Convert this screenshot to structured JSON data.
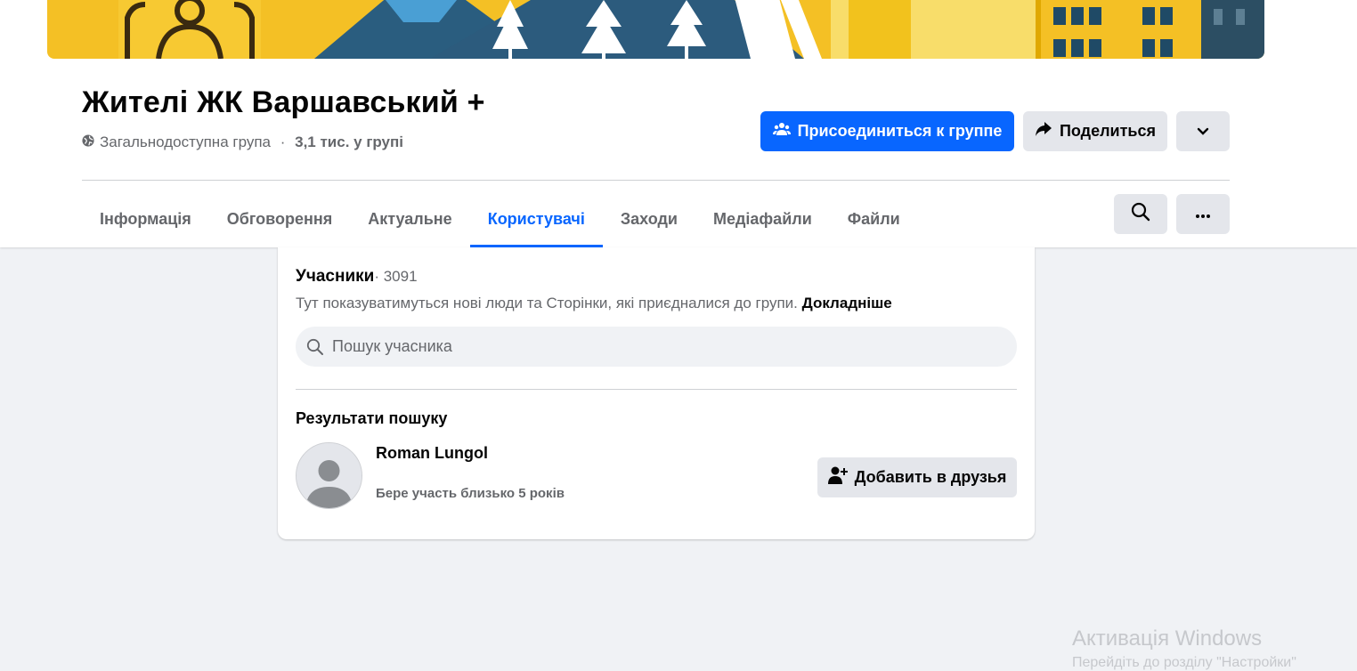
{
  "group": {
    "title": "Жителі ЖК Варшавський +",
    "privacy": "Загальнодоступна група",
    "separator": " · ",
    "members_count": "3,1 тис. у групі"
  },
  "actions": {
    "join_label": "Присоединиться к группе",
    "share_label": "Поделиться"
  },
  "tabs": [
    {
      "label": "Інформація",
      "active": false
    },
    {
      "label": "Обговорення",
      "active": false
    },
    {
      "label": "Актуальне",
      "active": false
    },
    {
      "label": "Користувачі",
      "active": true
    },
    {
      "label": "Заходи",
      "active": false
    },
    {
      "label": "Медіафайли",
      "active": false
    },
    {
      "label": "Файли",
      "active": false
    }
  ],
  "members_card": {
    "title": "Учасники",
    "count": "· 3091",
    "description": "Тут показуватимуться нові люди та Сторінки, які приєдналися до групи.",
    "learn_more": "Докладніше",
    "search_placeholder": "Пошук учасника",
    "results_heading": "Результати пошуку"
  },
  "results": [
    {
      "name": "Roman Lungol",
      "subtitle": "Бере участь близько 5 років",
      "button_label": "Добавить в друзья"
    }
  ],
  "watermark": {
    "title": "Активація Windows",
    "subtitle": "Перейдіть до розділу \"Настройки\""
  },
  "colors": {
    "primary": "#0866ff",
    "secondary_button": "#e4e6eb",
    "background": "#f0f2f5",
    "text": "#050505",
    "muted_text": "#65676b"
  }
}
